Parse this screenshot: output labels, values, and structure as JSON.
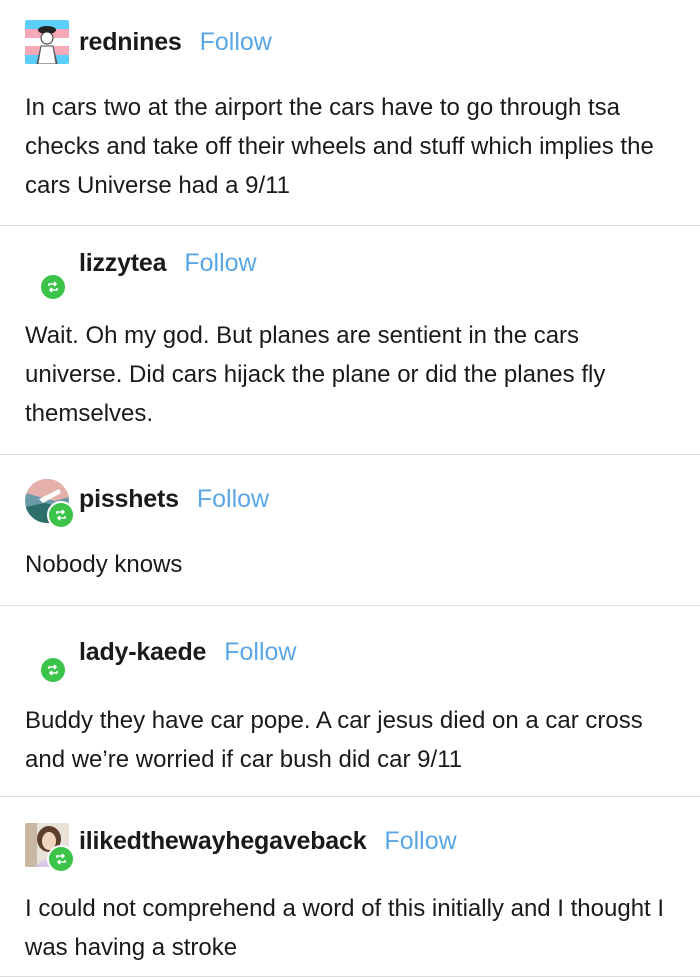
{
  "follow_label": "Follow",
  "posts": [
    {
      "username": "rednines",
      "text": "In cars two at the airport the cars have to go through tsa checks and take off their wheels and stuff which implies the cars Universe had a 9/11",
      "reblog": false
    },
    {
      "username": "lizzytea",
      "text": "Wait. Oh my god. But planes are sentient in the cars universe. Did cars hijack the plane or did the planes fly themselves.",
      "reblog": true
    },
    {
      "username": "pisshets",
      "text": "Nobody knows",
      "reblog": true
    },
    {
      "username": "lady-kaede",
      "text": "Buddy they have car pope. A car jesus died on a car cross and we’re worried if car bush did car 9/11",
      "reblog": true
    },
    {
      "username": "ilikedthewayhegaveback",
      "text": "I could not comprehend a word of this initially and I thought I was having a stroke",
      "reblog": true
    }
  ],
  "colors": {
    "follow": "#5aa6e6",
    "reblog_badge": "#3bc34a",
    "divider": "#dcdcdc"
  },
  "icons": {
    "reblog": "reblog-icon"
  }
}
